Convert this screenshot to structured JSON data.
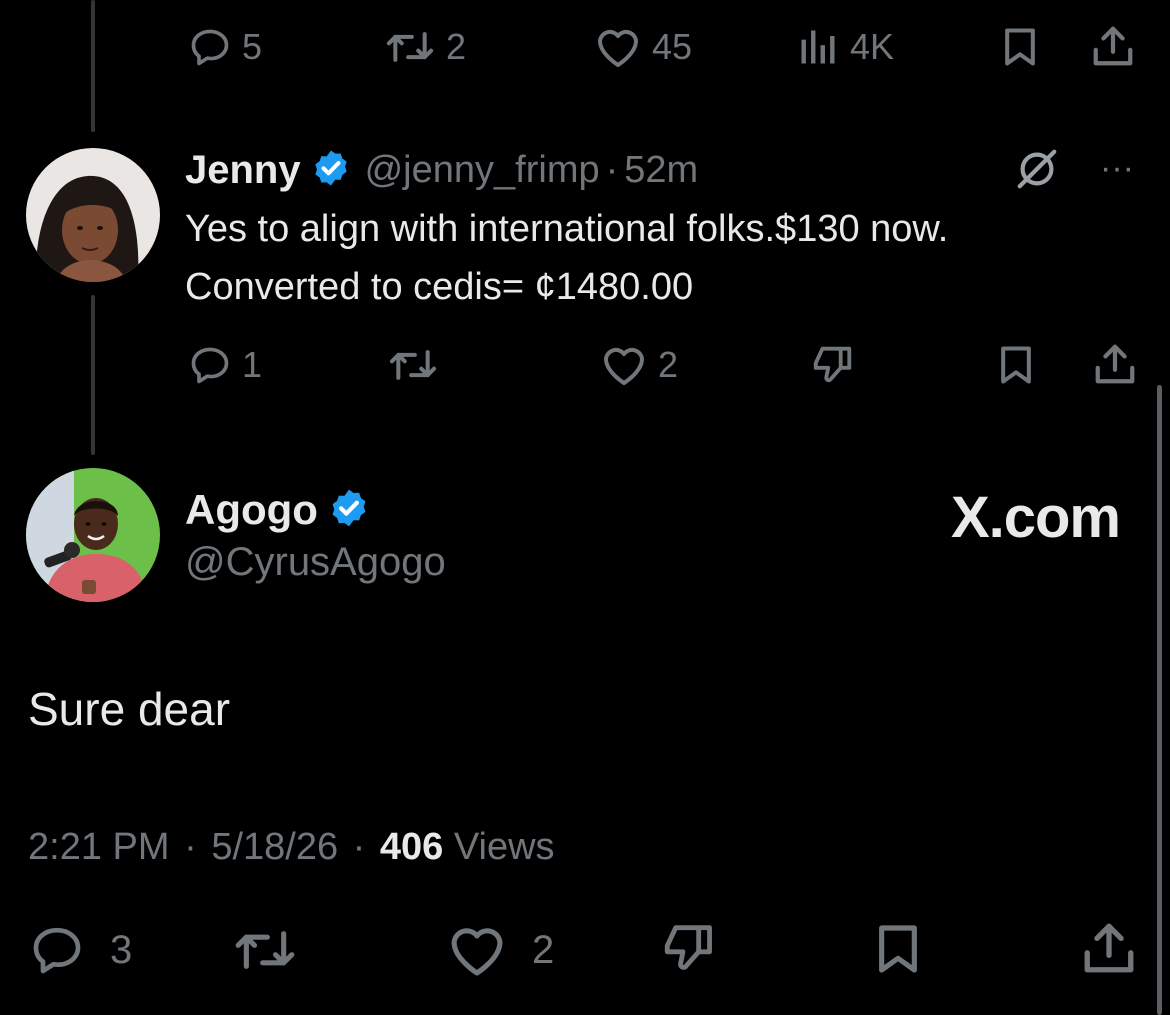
{
  "top_tweet_actions": {
    "replies": "5",
    "reposts": "2",
    "likes": "45",
    "views": "4K"
  },
  "jenny_reply": {
    "name": "Jenny",
    "handle": "@jenny_frimp",
    "separator": "·",
    "time": "52m",
    "text_line1": "Yes to align with international folks.$130 now.",
    "text_line2": "Converted to cedis= ¢1480.00",
    "replies": "1",
    "likes": "2",
    "more_glyph": "···"
  },
  "main_tweet": {
    "name": "Agogo",
    "handle": "@CyrusAgogo",
    "watermark": "X.com",
    "text": "Sure dear",
    "time": "2:21 PM",
    "sep1": "·",
    "date": "5/18/26",
    "sep2": "·",
    "views_count": "406",
    "views_label": "Views",
    "replies": "3",
    "likes": "2"
  },
  "colors": {
    "background": "#000000",
    "text": "#e7e9ea",
    "muted": "#71767b",
    "verified": "#1d9bf0",
    "thread_line": "#333639"
  },
  "icons": [
    "reply-icon",
    "repost-icon",
    "like-icon",
    "views-icon",
    "bookmark-icon",
    "share-icon",
    "grok-icon",
    "more-icon",
    "dislike-icon",
    "verified-badge-icon"
  ]
}
